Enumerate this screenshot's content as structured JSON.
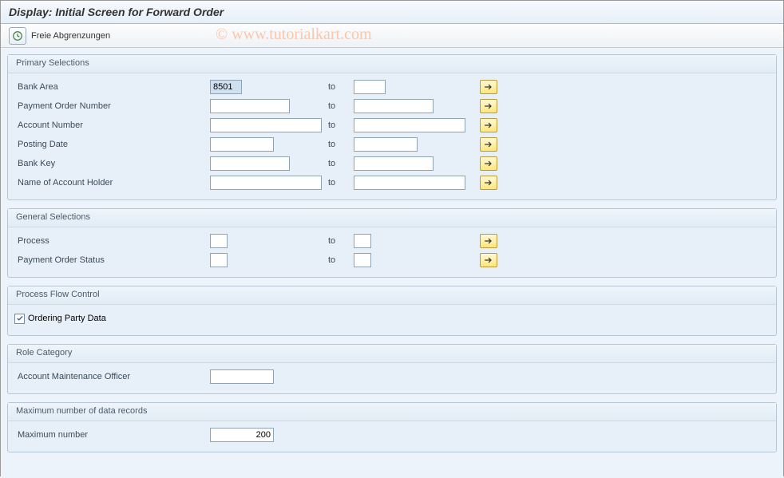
{
  "title": "Display: Initial Screen for Forward Order",
  "toolbar": {
    "free_delimitations": "Freie Abgrenzungen"
  },
  "watermark": "© www.tutorialkart.com",
  "groups": {
    "primary": {
      "title": "Primary Selections",
      "rows": {
        "bank_area": {
          "label": "Bank Area",
          "from": "8501",
          "to_label": "to",
          "to": ""
        },
        "po_number": {
          "label": "Payment Order Number",
          "from": "",
          "to_label": "to",
          "to": ""
        },
        "account_no": {
          "label": "Account Number",
          "from": "",
          "to_label": "to",
          "to": ""
        },
        "posting": {
          "label": "Posting Date",
          "from": "",
          "to_label": "to",
          "to": ""
        },
        "bank_key": {
          "label": "Bank Key",
          "from": "",
          "to_label": "to",
          "to": ""
        },
        "holder": {
          "label": "Name of Account Holder",
          "from": "",
          "to_label": "to",
          "to": ""
        }
      }
    },
    "general": {
      "title": "General Selections",
      "rows": {
        "process": {
          "label": "Process",
          "from": "",
          "to_label": "to",
          "to": ""
        },
        "status": {
          "label": "Payment Order Status",
          "from": "",
          "to_label": "to",
          "to": ""
        }
      }
    },
    "flow": {
      "title": "Process Flow Control",
      "ordering_party": {
        "label": "Ordering Party Data",
        "checked": true
      }
    },
    "role": {
      "title": "Role Category",
      "officer": {
        "label": "Account Maintenance Officer",
        "value": ""
      }
    },
    "max": {
      "title": "Maximum number of data records",
      "maxnum": {
        "label": "Maximum number",
        "value": "200"
      }
    }
  }
}
